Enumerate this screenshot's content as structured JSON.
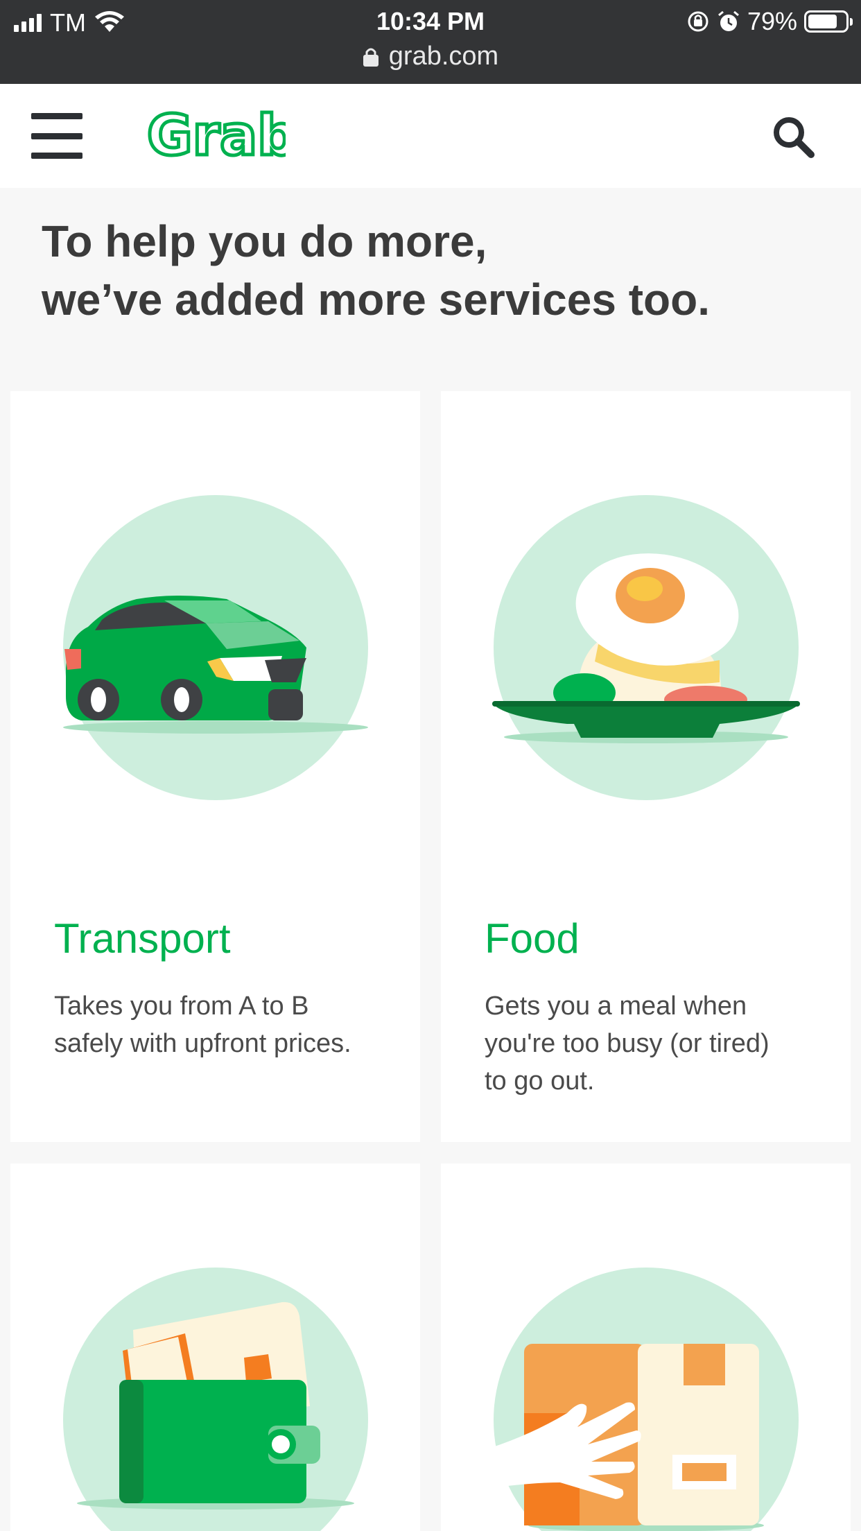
{
  "status_bar": {
    "carrier": "TM",
    "time": "10:34 PM",
    "battery": "79%",
    "battery_level": 0.79,
    "url": "grab.com"
  },
  "header": {
    "logo_text": "Grab",
    "brand_color": "#00b14f"
  },
  "headline": {
    "line1": "To help you do more,",
    "line2": "we’ve added more services too."
  },
  "services": [
    {
      "title": "Transport",
      "description_lines": [
        "Takes you from A to B",
        "safely with upfront prices."
      ],
      "icon": "car-icon"
    },
    {
      "title": "Food",
      "description_lines": [
        "Gets you a meal when",
        "you're too busy (or tired)",
        "to go out."
      ],
      "icon": "food-plate-icon"
    },
    {
      "title": "",
      "description_lines": [],
      "icon": "wallet-icon"
    },
    {
      "title": "",
      "description_lines": [],
      "icon": "delivery-box-icon"
    }
  ],
  "colors": {
    "circle_bg": "#cdeedd",
    "text_dark": "#3b3b3b",
    "status_bar_bg": "#333436"
  }
}
